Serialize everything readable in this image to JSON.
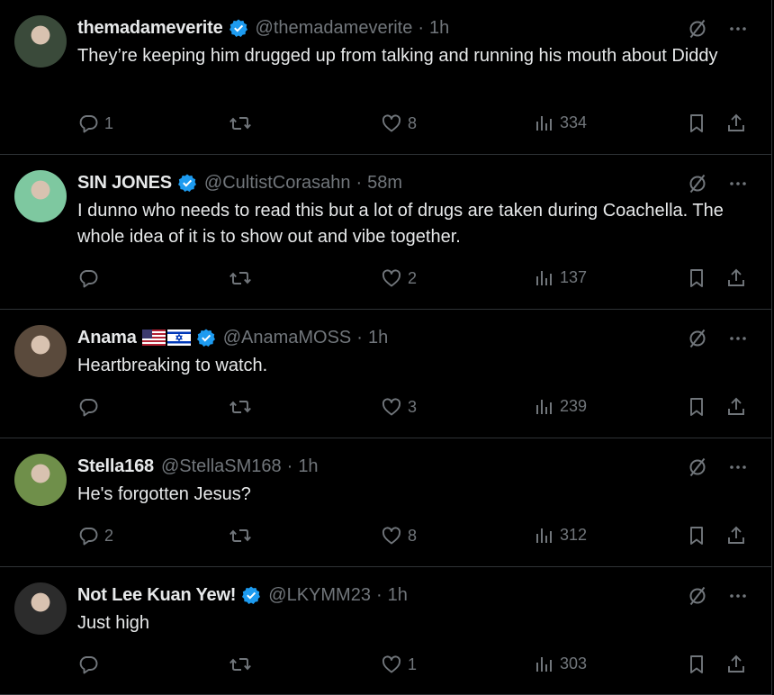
{
  "tweets": [
    {
      "name": "themadameverite",
      "handle": "@themadameverite",
      "time": "1h",
      "verified": true,
      "text": "They’re keeping him drugged up from talking and running his mouth about Diddy",
      "replies": "1",
      "retweets": "",
      "likes": "8",
      "views": "334",
      "avatar_color": "#3a4a3a"
    },
    {
      "name": "SIN JONES",
      "handle": "@CultistCorasahn",
      "time": "58m",
      "verified": true,
      "text": "I dunno who needs to read this but a lot of drugs are taken during Coachella.  The whole idea of it is to show out and vibe together.",
      "replies": "",
      "retweets": "",
      "likes": "2",
      "views": "137",
      "avatar_color": "#7ec8a0"
    },
    {
      "name": "Anama",
      "handle": "@AnamaMOSS",
      "time": "1h",
      "verified": true,
      "flags": [
        "us-flag",
        "israel-flag"
      ],
      "text": "Heartbreaking to watch.",
      "replies": "",
      "retweets": "",
      "likes": "3",
      "views": "239",
      "avatar_color": "#5a4a3c"
    },
    {
      "name": "Stella168",
      "handle": "@StellaSM168",
      "time": "1h",
      "verified": false,
      "text": "He's forgotten Jesus?",
      "replies": "2",
      "retweets": "",
      "likes": "8",
      "views": "312",
      "avatar_color": "#6f8f4a"
    },
    {
      "name": "Not Lee Kuan Yew!",
      "handle": "@LKYMM23",
      "time": "1h",
      "verified": true,
      "text": "Just high",
      "replies": "",
      "retweets": "",
      "likes": "1",
      "views": "303",
      "avatar_color": "#2c2c2c"
    }
  ],
  "colors": {
    "background": "#000000",
    "text": "#e7e9ea",
    "muted": "#71767b",
    "verified": "#1d9bf0",
    "divider": "#2f3336"
  },
  "icons": [
    "grok-icon",
    "more-icon",
    "reply-icon",
    "retweet-icon",
    "like-icon",
    "views-icon",
    "bookmark-icon",
    "share-icon",
    "verified-icon"
  ]
}
